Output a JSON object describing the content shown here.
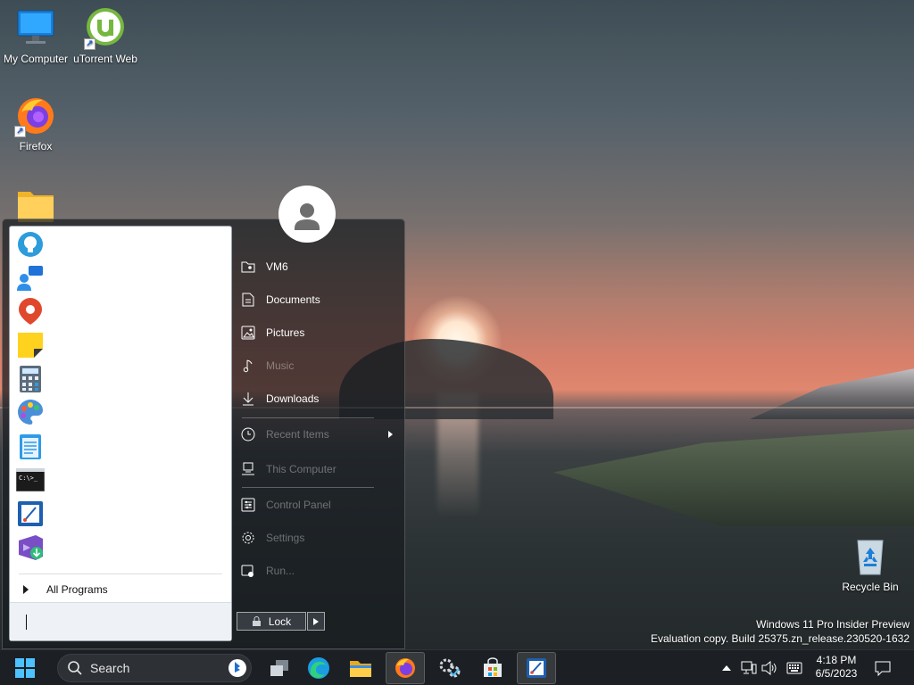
{
  "desktop": {
    "icons": [
      {
        "label": "My Computer",
        "icon": "monitor-icon"
      },
      {
        "label": "uTorrent Web",
        "icon": "utorrent-icon"
      },
      {
        "label": "Firefox",
        "icon": "firefox-icon"
      },
      {
        "label": "",
        "icon": "folder-icon"
      },
      {
        "label": "Recycle Bin",
        "icon": "recycle-bin-icon"
      }
    ],
    "watermark": {
      "line1": "Windows 11 Pro Insider Preview",
      "line2": "Evaluation copy. Build 25375.zn_release.230520-1632"
    }
  },
  "start_menu": {
    "pinned_programs": [
      {
        "icon": "tips-lightbulb-icon"
      },
      {
        "icon": "people-chat-icon"
      },
      {
        "icon": "maps-pin-icon"
      },
      {
        "icon": "sticky-notes-icon"
      },
      {
        "icon": "calculator-icon"
      },
      {
        "icon": "paint-palette-icon"
      },
      {
        "icon": "notepad-icon"
      },
      {
        "icon": "command-prompt-icon"
      },
      {
        "icon": "snipping-tool-icon"
      },
      {
        "icon": "visual-studio-installer-icon"
      }
    ],
    "all_programs_label": "All Programs",
    "search_value": "",
    "right_items": [
      {
        "label": "VM6",
        "icon": "user-folder-icon"
      },
      {
        "label": "Documents",
        "icon": "document-icon"
      },
      {
        "label": "Pictures",
        "icon": "picture-icon"
      },
      {
        "label": "Music",
        "icon": "music-note-icon"
      },
      {
        "label": "Downloads",
        "icon": "download-icon"
      },
      {
        "label": "Recent Items",
        "icon": "clock-icon"
      },
      {
        "label": "This Computer",
        "icon": "computer-icon"
      },
      {
        "label": "Control Panel",
        "icon": "control-panel-icon"
      },
      {
        "label": "Settings",
        "icon": "gear-icon"
      },
      {
        "label": "Run...",
        "icon": "run-icon"
      }
    ],
    "lock_label": "Lock"
  },
  "taskbar": {
    "search_placeholder": "Search",
    "apps": [
      {
        "icon": "task-view-icon"
      },
      {
        "icon": "edge-icon"
      },
      {
        "icon": "file-explorer-icon"
      },
      {
        "icon": "firefox-icon",
        "active": true
      },
      {
        "icon": "settings-manager-icon"
      },
      {
        "icon": "microsoft-store-icon"
      },
      {
        "icon": "snipping-tool-icon",
        "active": true
      }
    ],
    "tray": {
      "time": "4:18 PM",
      "date": "6/5/2023"
    }
  }
}
